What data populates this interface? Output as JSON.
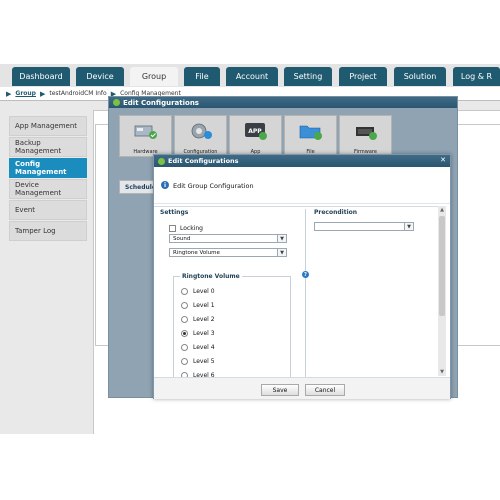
{
  "tabs": [
    {
      "label": "Dashboard"
    },
    {
      "label": "Device"
    },
    {
      "label": "Group"
    },
    {
      "label": "File"
    },
    {
      "label": "Account"
    },
    {
      "label": "Setting"
    },
    {
      "label": "Project"
    },
    {
      "label": "Solution"
    },
    {
      "label": "Log & R"
    }
  ],
  "breadcrumb": {
    "root": "Group",
    "item1": "testAndroidCM Info",
    "item2": "Config Management"
  },
  "sidebar": {
    "items": [
      {
        "label": "App Management"
      },
      {
        "label": "Backup Management"
      },
      {
        "label": "Config Management"
      },
      {
        "label": "Device Management"
      },
      {
        "label": "Event"
      },
      {
        "label": "Tamper Log"
      }
    ]
  },
  "dialog_outer": {
    "title": "Edit Configurations",
    "icons": [
      {
        "label": "Hardware",
        "icon": "hardware-icon"
      },
      {
        "label": "Configuration",
        "icon": "configuration-gear-icon"
      },
      {
        "label": "App",
        "icon": "app-icon"
      },
      {
        "label": "File",
        "icon": "folder-icon"
      },
      {
        "label": "Firmware",
        "icon": "chip-icon"
      }
    ],
    "schedule_label": "Schedule"
  },
  "dialog_inner": {
    "title": "Edit Configurations",
    "header_text": "Edit Group Configuration",
    "settings_title": "Settings",
    "locking_label": "Locking",
    "sound_select": "Sound",
    "ringtone_select": "Ringtone Volume",
    "ringtone_group_title": "Ringtone Volume",
    "levels": [
      {
        "label": "Level 0",
        "checked": false
      },
      {
        "label": "Level 1",
        "checked": false
      },
      {
        "label": "Level 2",
        "checked": false
      },
      {
        "label": "Level 3",
        "checked": true
      },
      {
        "label": "Level 4",
        "checked": false
      },
      {
        "label": "Level 5",
        "checked": false
      },
      {
        "label": "Level 6",
        "checked": false
      }
    ],
    "precondition_title": "Precondition",
    "precondition_value": "",
    "save_label": "Save",
    "cancel_label": "Cancel"
  },
  "colors": {
    "tab_dark": "#1f5a70",
    "sidebar_active": "#1a8dbe",
    "title_bar": "#2c5670"
  }
}
